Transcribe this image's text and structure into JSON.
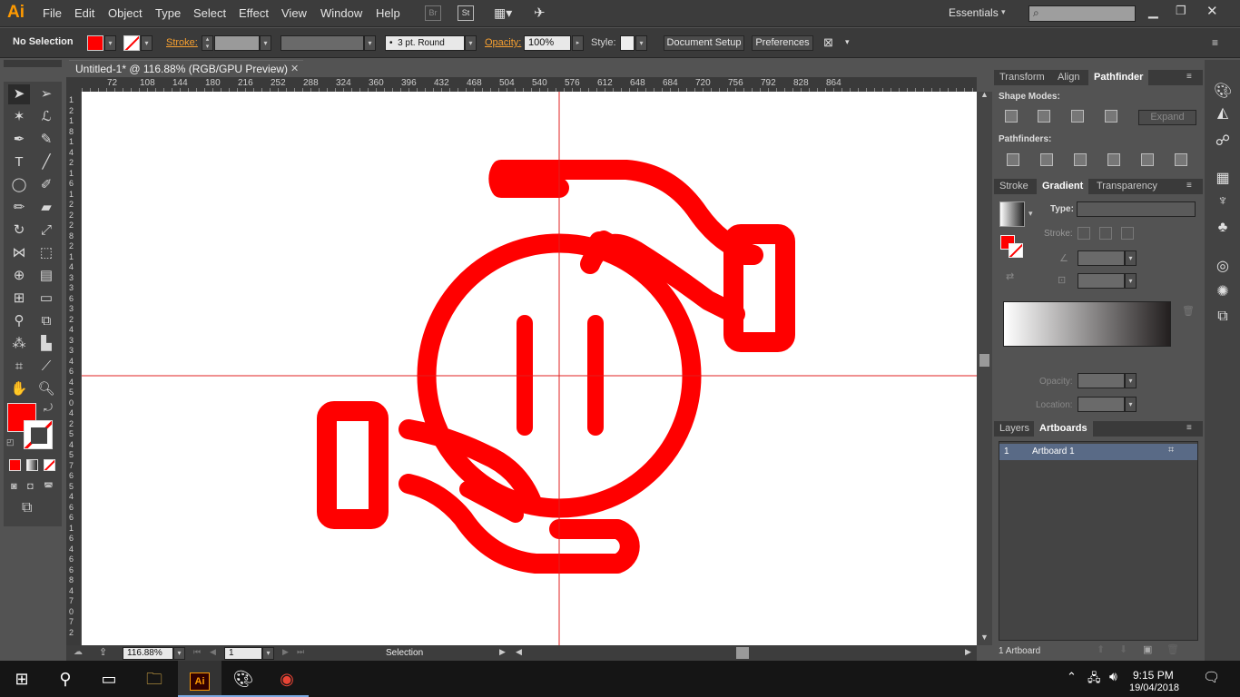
{
  "app": {
    "logo": "Ai"
  },
  "menu": [
    "File",
    "Edit",
    "Object",
    "Type",
    "Select",
    "Effect",
    "View",
    "Window",
    "Help"
  ],
  "menubar_extra": {
    "br": "Br",
    "st": "St",
    "workspace": "Essentials",
    "search_placeholder": ""
  },
  "control": {
    "selection": "No Selection",
    "stroke_label": "Stroke:",
    "brush": "3 pt. Round",
    "opacity_label": "Opacity:",
    "opacity_value": "100%",
    "style_label": "Style:",
    "doc_setup": "Document Setup",
    "preferences": "Preferences",
    "fill_color": "#ff0000"
  },
  "document": {
    "tab_title": "Untitled-1* @ 116.88% (RGB/GPU Preview)",
    "ruler_top": [
      "72",
      "108",
      "144",
      "180",
      "216",
      "252",
      "288",
      "324",
      "360",
      "396",
      "432",
      "468",
      "504",
      "540",
      "576",
      "612",
      "648",
      "684",
      "720",
      "756",
      "792",
      "828",
      "864"
    ],
    "ruler_left": [
      "1",
      "2",
      "1",
      "8",
      "1",
      "4",
      "2",
      "1",
      "6",
      "1",
      "2",
      "2",
      "2",
      "8",
      "2",
      "1",
      "4",
      "3",
      "3",
      "6",
      "3",
      "2",
      "4",
      "3",
      "3",
      "4",
      "6",
      "4",
      "5",
      "0",
      "4",
      "2",
      "5",
      "4",
      "5",
      "7",
      "6",
      "5",
      "4",
      "6",
      "6",
      "1",
      "6",
      "4",
      "6",
      "6",
      "8",
      "4",
      "7",
      "0",
      "7",
      "2"
    ]
  },
  "status": {
    "zoom": "116.88%",
    "page": "1",
    "tool": "Selection"
  },
  "panels": {
    "top_tabs": [
      "Transform",
      "Align",
      "Pathfinder"
    ],
    "shape_modes": "Shape Modes:",
    "expand": "Expand",
    "pathfinders": "Pathfinders:",
    "mid_tabs": [
      "Stroke",
      "Gradient",
      "Transparency"
    ],
    "type_label": "Type:",
    "stroke_label": "Stroke:",
    "opacity_label": "Opacity:",
    "location_label": "Location:",
    "bottom_tabs": [
      "Layers",
      "Artboards"
    ],
    "artboard_row": {
      "num": "1",
      "name": "Artboard 1"
    },
    "artboard_count": "1 Artboard"
  },
  "taskbar": {
    "time": "9:15 PM",
    "date": "19/04/2018"
  },
  "colors": {
    "accent_red": "#ff0000",
    "guide": "#e02020"
  }
}
